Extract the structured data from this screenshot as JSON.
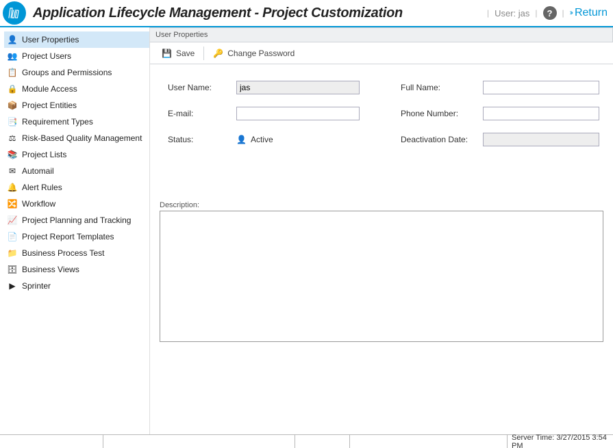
{
  "header": {
    "title": "Application Lifecycle Management - Project Customization",
    "user_prefix": "User:",
    "user_name": "jas",
    "return_label": "Return"
  },
  "sidebar": {
    "items": [
      {
        "label": "User Properties",
        "icon": "👤",
        "selected": true
      },
      {
        "label": "Project Users",
        "icon": "👥",
        "selected": false
      },
      {
        "label": "Groups and Permissions",
        "icon": "📋",
        "selected": false
      },
      {
        "label": "Module Access",
        "icon": "🔒",
        "selected": false
      },
      {
        "label": "Project Entities",
        "icon": "📦",
        "selected": false
      },
      {
        "label": "Requirement Types",
        "icon": "📑",
        "selected": false
      },
      {
        "label": "Risk-Based Quality Management",
        "icon": "⚖",
        "selected": false
      },
      {
        "label": "Project Lists",
        "icon": "📚",
        "selected": false
      },
      {
        "label": "Automail",
        "icon": "✉",
        "selected": false
      },
      {
        "label": "Alert Rules",
        "icon": "🔔",
        "selected": false
      },
      {
        "label": "Workflow",
        "icon": "🔀",
        "selected": false
      },
      {
        "label": "Project Planning and Tracking",
        "icon": "📈",
        "selected": false
      },
      {
        "label": "Project Report Templates",
        "icon": "📄",
        "selected": false
      },
      {
        "label": "Business Process Test",
        "icon": "📁",
        "selected": false
      },
      {
        "label": "Business Views",
        "icon": "🗄",
        "selected": false
      },
      {
        "label": "Sprinter",
        "icon": "▶",
        "selected": false
      }
    ]
  },
  "panel": {
    "title": "User Properties",
    "toolbar": {
      "save": "Save",
      "change_password": "Change Password"
    },
    "fields": {
      "user_name_label": "User Name:",
      "user_name_value": "jas",
      "full_name_label": "Full Name:",
      "full_name_value": "",
      "email_label": "E-mail:",
      "email_value": "",
      "phone_label": "Phone Number:",
      "phone_value": "",
      "status_label": "Status:",
      "status_value": "Active",
      "deact_label": "Deactivation Date:",
      "deact_value": ""
    },
    "description_label": "Description:"
  },
  "statusbar": {
    "server_time": "Server Time: 3/27/2015 3:54 PM"
  }
}
